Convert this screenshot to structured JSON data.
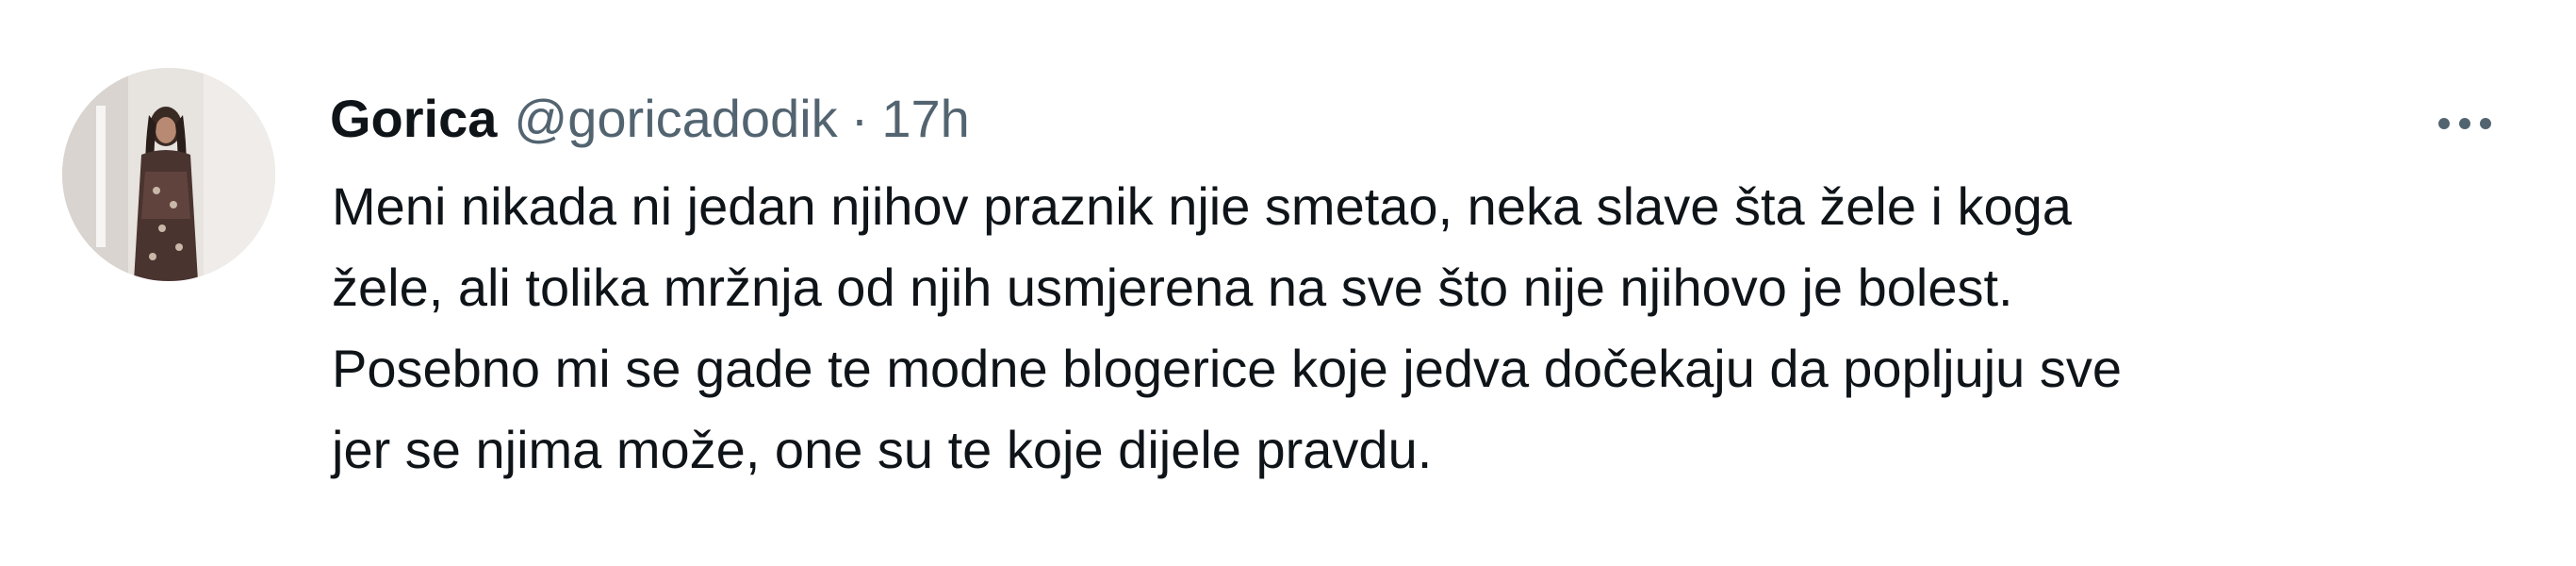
{
  "tweet": {
    "author": {
      "display_name": "Gorica",
      "handle": "@goricadodik",
      "avatar": "profile-photo"
    },
    "separator": "·",
    "timestamp": "17h",
    "more_icon": "more-horizontal-icon",
    "text_lines": [
      "Meni nikada ni jedan njihov praznik njie smetao, neka slave šta žele i koga",
      "žele, ali tolika mržnja od njih usmjerena na sve što nije njihovo je bolest.",
      "Posebno mi se gade te modne blogerice koje jedva dočekaju da popljuju sve",
      "jer se njima može, one su te koje dijele pravdu."
    ]
  },
  "colors": {
    "text_primary": "#0f1419",
    "text_secondary": "#536471",
    "background": "#ffffff"
  }
}
